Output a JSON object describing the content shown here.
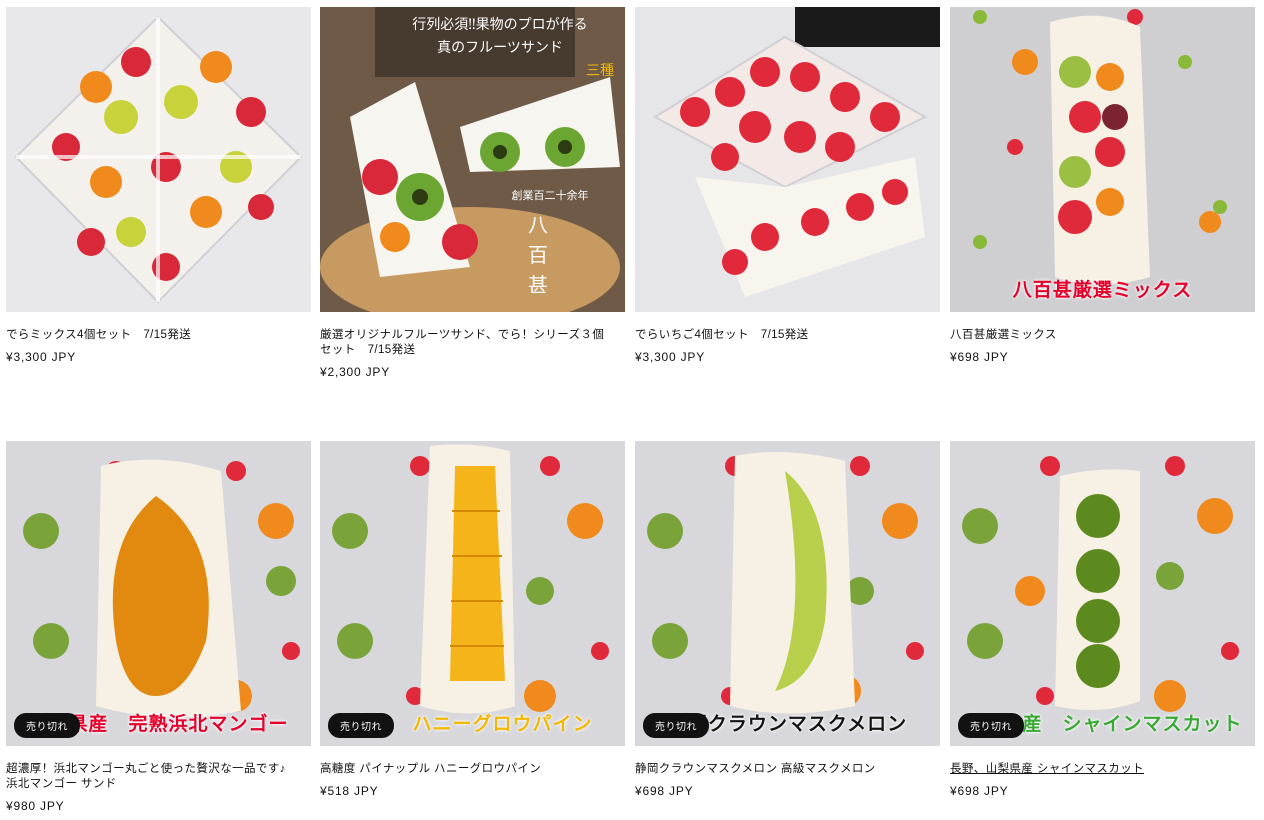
{
  "products": [
    {
      "title": "でらミックス4個セット　7/15発送",
      "price": "¥3,300 JPY",
      "badge": "",
      "overlay": "",
      "overlay_color": "#e4002b"
    },
    {
      "title": "厳選オリジナルフルーツサンド、でら！シリーズ３個セット　7/15発送",
      "price": "¥2,300 JPY",
      "badge": "",
      "overlay": "",
      "overlay_color": "#ffffff"
    },
    {
      "title": "でらいちご4個セット　7/15発送",
      "price": "¥3,300 JPY",
      "badge": "",
      "overlay": "",
      "overlay_color": "#e4002b"
    },
    {
      "title": "八百甚厳選ミックス",
      "price": "¥698 JPY",
      "badge": "",
      "overlay": "八百甚厳選ミックス",
      "overlay_color": "#e4002b"
    },
    {
      "title": "超濃厚！浜北マンゴー丸ごと使った贅沢な一品です♪ 浜北マンゴー サンド",
      "price": "¥980 JPY",
      "badge": "売り切れ",
      "overlay": "静岡県産　完熟浜北マンゴー",
      "overlay_color": "#e4002b"
    },
    {
      "title": "高糖度 パイナップル ハニーグロウパイン",
      "price": "¥518 JPY",
      "badge": "売り切れ",
      "overlay": "完熟　ハニーグロウパイン",
      "overlay_color": "#f2b705"
    },
    {
      "title": "静岡クラウンマスクメロン 高級マスクメロン",
      "price": "¥698 JPY",
      "badge": "売り切れ",
      "overlay": "静岡クラウンマスクメロン",
      "overlay_color": "#121212"
    },
    {
      "title": "長野、山梨県産 シャインマスカット",
      "price": "¥698 JPY",
      "badge": "売り切れ",
      "overlay": "長野県産　シャインマスカット",
      "overlay_color": "#39a935"
    }
  ],
  "image_text": {
    "p2_line1": "行列必須‼果物のプロが作る",
    "p2_line2": "真のフルーツサンド",
    "p2_line3": "三種",
    "p2_line4": "創業百二十余年",
    "p2_brand1": "八",
    "p2_brand2": "百",
    "p2_brand3": "甚"
  },
  "colors": {
    "badge_bg": "#121212",
    "background": "#ffffff",
    "text": "#121212"
  }
}
